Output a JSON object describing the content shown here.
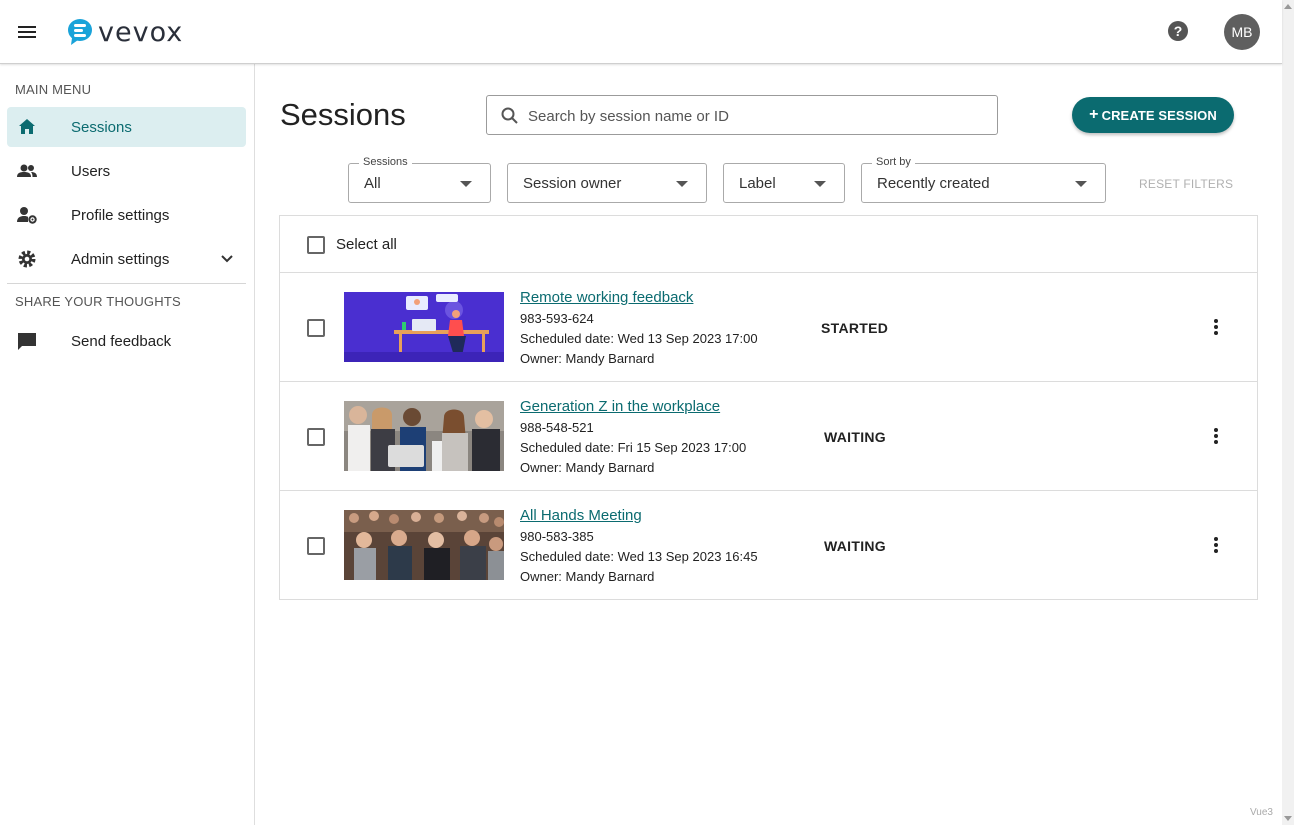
{
  "app": {
    "logo_text": "vevox",
    "user_initials": "MB"
  },
  "sidebar": {
    "main_heading": "MAIN MENU",
    "items": [
      {
        "label": "Sessions",
        "icon": "home-icon",
        "active": true
      },
      {
        "label": "Users",
        "icon": "users-icon"
      },
      {
        "label": "Profile settings",
        "icon": "profile-settings-icon"
      },
      {
        "label": "Admin settings",
        "icon": "gear-icon",
        "expandable": true
      }
    ],
    "thoughts_heading": "SHARE YOUR THOUGHTS",
    "feedback_label": "Send feedback"
  },
  "main": {
    "title": "Sessions",
    "search_placeholder": "Search by session name or ID",
    "create_label": "CREATE SESSION",
    "filters": {
      "sessions": {
        "label": "Sessions",
        "value": "All"
      },
      "owner": {
        "value": "Session owner"
      },
      "label": {
        "value": "Label"
      },
      "sort": {
        "label": "Sort by",
        "value": "Recently created"
      },
      "reset_label": "RESET FILTERS"
    },
    "select_all_label": "Select all",
    "sessions": [
      {
        "title": "Remote working feedback",
        "id": "983-593-624",
        "scheduled": "Scheduled date: Wed 13 Sep 2023 17:00",
        "owner": "Owner: Mandy Barnard",
        "status": "STARTED"
      },
      {
        "title": "Generation Z in the workplace",
        "id": "988-548-521",
        "scheduled": "Scheduled date: Fri 15 Sep 2023 17:00",
        "owner": "Owner: Mandy Barnard",
        "status": "WAITING"
      },
      {
        "title": "All Hands Meeting",
        "id": "980-583-385",
        "scheduled": "Scheduled date: Wed 13 Sep 2023 16:45",
        "owner": "Owner: Mandy Barnard",
        "status": "WAITING"
      }
    ]
  },
  "footer": {
    "version": "Vue3"
  },
  "colors": {
    "accent": "#0b6b70",
    "active_bg": "#dceef0",
    "avatar_bg": "#5f5f5f"
  }
}
